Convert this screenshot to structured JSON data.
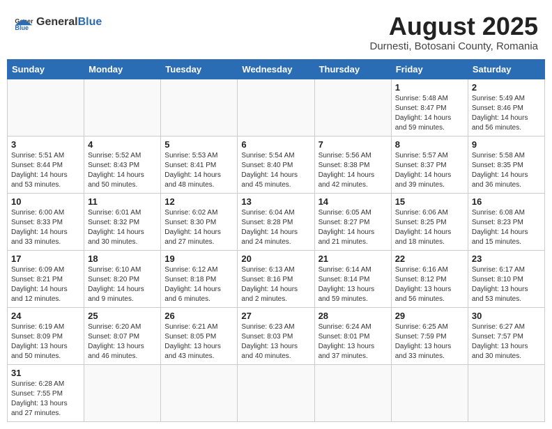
{
  "header": {
    "logo_general": "General",
    "logo_blue": "Blue",
    "month_title": "August 2025",
    "location": "Durnesti, Botosani County, Romania"
  },
  "weekdays": [
    "Sunday",
    "Monday",
    "Tuesday",
    "Wednesday",
    "Thursday",
    "Friday",
    "Saturday"
  ],
  "weeks": [
    [
      {
        "day": "",
        "info": ""
      },
      {
        "day": "",
        "info": ""
      },
      {
        "day": "",
        "info": ""
      },
      {
        "day": "",
        "info": ""
      },
      {
        "day": "",
        "info": ""
      },
      {
        "day": "1",
        "info": "Sunrise: 5:48 AM\nSunset: 8:47 PM\nDaylight: 14 hours and 59 minutes."
      },
      {
        "day": "2",
        "info": "Sunrise: 5:49 AM\nSunset: 8:46 PM\nDaylight: 14 hours and 56 minutes."
      }
    ],
    [
      {
        "day": "3",
        "info": "Sunrise: 5:51 AM\nSunset: 8:44 PM\nDaylight: 14 hours and 53 minutes."
      },
      {
        "day": "4",
        "info": "Sunrise: 5:52 AM\nSunset: 8:43 PM\nDaylight: 14 hours and 50 minutes."
      },
      {
        "day": "5",
        "info": "Sunrise: 5:53 AM\nSunset: 8:41 PM\nDaylight: 14 hours and 48 minutes."
      },
      {
        "day": "6",
        "info": "Sunrise: 5:54 AM\nSunset: 8:40 PM\nDaylight: 14 hours and 45 minutes."
      },
      {
        "day": "7",
        "info": "Sunrise: 5:56 AM\nSunset: 8:38 PM\nDaylight: 14 hours and 42 minutes."
      },
      {
        "day": "8",
        "info": "Sunrise: 5:57 AM\nSunset: 8:37 PM\nDaylight: 14 hours and 39 minutes."
      },
      {
        "day": "9",
        "info": "Sunrise: 5:58 AM\nSunset: 8:35 PM\nDaylight: 14 hours and 36 minutes."
      }
    ],
    [
      {
        "day": "10",
        "info": "Sunrise: 6:00 AM\nSunset: 8:33 PM\nDaylight: 14 hours and 33 minutes."
      },
      {
        "day": "11",
        "info": "Sunrise: 6:01 AM\nSunset: 8:32 PM\nDaylight: 14 hours and 30 minutes."
      },
      {
        "day": "12",
        "info": "Sunrise: 6:02 AM\nSunset: 8:30 PM\nDaylight: 14 hours and 27 minutes."
      },
      {
        "day": "13",
        "info": "Sunrise: 6:04 AM\nSunset: 8:28 PM\nDaylight: 14 hours and 24 minutes."
      },
      {
        "day": "14",
        "info": "Sunrise: 6:05 AM\nSunset: 8:27 PM\nDaylight: 14 hours and 21 minutes."
      },
      {
        "day": "15",
        "info": "Sunrise: 6:06 AM\nSunset: 8:25 PM\nDaylight: 14 hours and 18 minutes."
      },
      {
        "day": "16",
        "info": "Sunrise: 6:08 AM\nSunset: 8:23 PM\nDaylight: 14 hours and 15 minutes."
      }
    ],
    [
      {
        "day": "17",
        "info": "Sunrise: 6:09 AM\nSunset: 8:21 PM\nDaylight: 14 hours and 12 minutes."
      },
      {
        "day": "18",
        "info": "Sunrise: 6:10 AM\nSunset: 8:20 PM\nDaylight: 14 hours and 9 minutes."
      },
      {
        "day": "19",
        "info": "Sunrise: 6:12 AM\nSunset: 8:18 PM\nDaylight: 14 hours and 6 minutes."
      },
      {
        "day": "20",
        "info": "Sunrise: 6:13 AM\nSunset: 8:16 PM\nDaylight: 14 hours and 2 minutes."
      },
      {
        "day": "21",
        "info": "Sunrise: 6:14 AM\nSunset: 8:14 PM\nDaylight: 13 hours and 59 minutes."
      },
      {
        "day": "22",
        "info": "Sunrise: 6:16 AM\nSunset: 8:12 PM\nDaylight: 13 hours and 56 minutes."
      },
      {
        "day": "23",
        "info": "Sunrise: 6:17 AM\nSunset: 8:10 PM\nDaylight: 13 hours and 53 minutes."
      }
    ],
    [
      {
        "day": "24",
        "info": "Sunrise: 6:19 AM\nSunset: 8:09 PM\nDaylight: 13 hours and 50 minutes."
      },
      {
        "day": "25",
        "info": "Sunrise: 6:20 AM\nSunset: 8:07 PM\nDaylight: 13 hours and 46 minutes."
      },
      {
        "day": "26",
        "info": "Sunrise: 6:21 AM\nSunset: 8:05 PM\nDaylight: 13 hours and 43 minutes."
      },
      {
        "day": "27",
        "info": "Sunrise: 6:23 AM\nSunset: 8:03 PM\nDaylight: 13 hours and 40 minutes."
      },
      {
        "day": "28",
        "info": "Sunrise: 6:24 AM\nSunset: 8:01 PM\nDaylight: 13 hours and 37 minutes."
      },
      {
        "day": "29",
        "info": "Sunrise: 6:25 AM\nSunset: 7:59 PM\nDaylight: 13 hours and 33 minutes."
      },
      {
        "day": "30",
        "info": "Sunrise: 6:27 AM\nSunset: 7:57 PM\nDaylight: 13 hours and 30 minutes."
      }
    ],
    [
      {
        "day": "31",
        "info": "Sunrise: 6:28 AM\nSunset: 7:55 PM\nDaylight: 13 hours and 27 minutes."
      },
      {
        "day": "",
        "info": ""
      },
      {
        "day": "",
        "info": ""
      },
      {
        "day": "",
        "info": ""
      },
      {
        "day": "",
        "info": ""
      },
      {
        "day": "",
        "info": ""
      },
      {
        "day": "",
        "info": ""
      }
    ]
  ]
}
